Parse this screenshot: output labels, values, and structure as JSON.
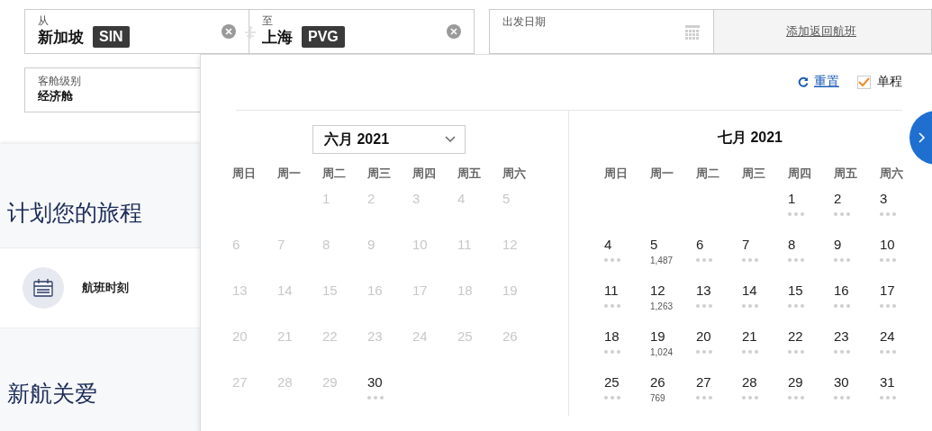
{
  "search": {
    "origin": {
      "label": "从",
      "city": "新加坡",
      "code": "SIN"
    },
    "destination": {
      "label": "至",
      "city": "上海",
      "code": "PVG"
    },
    "departure": {
      "label": "出发日期"
    },
    "return_link": "添加返回航班",
    "cabin": {
      "label": "客舱级别",
      "value": "经济舱"
    }
  },
  "sidebar": {
    "heading": "计划您的旅程",
    "items": [
      {
        "label": "航班时刻"
      }
    ],
    "heading_2": "新航关爱"
  },
  "calendar": {
    "reset": "重置",
    "one_way": {
      "label": "单程",
      "checked": true
    },
    "months": [
      {
        "title": "六月 2021",
        "kind": "select",
        "weekdays": [
          "周日",
          "周一",
          "周二",
          "周三",
          "周四",
          "周五",
          "周六"
        ],
        "weeks": [
          [
            {
              "kind": "empty"
            },
            {
              "kind": "empty"
            },
            {
              "kind": "day",
              "day": "1",
              "disabled": true,
              "dots": false
            },
            {
              "kind": "day",
              "day": "2",
              "disabled": true,
              "dots": false
            },
            {
              "kind": "day",
              "day": "3",
              "disabled": true,
              "dots": false
            },
            {
              "kind": "day",
              "day": "4",
              "disabled": true,
              "dots": false
            },
            {
              "kind": "day",
              "day": "5",
              "disabled": true,
              "dots": false
            }
          ],
          [
            {
              "kind": "day",
              "day": "6",
              "disabled": true,
              "dots": false
            },
            {
              "kind": "day",
              "day": "7",
              "disabled": true,
              "dots": false
            },
            {
              "kind": "day",
              "day": "8",
              "disabled": true,
              "dots": false
            },
            {
              "kind": "day",
              "day": "9",
              "disabled": true,
              "dots": false
            },
            {
              "kind": "day",
              "day": "10",
              "disabled": true,
              "dots": false
            },
            {
              "kind": "day",
              "day": "11",
              "disabled": true,
              "dots": false
            },
            {
              "kind": "day",
              "day": "12",
              "disabled": true,
              "dots": false
            }
          ],
          [
            {
              "kind": "day",
              "day": "13",
              "disabled": true,
              "dots": false
            },
            {
              "kind": "day",
              "day": "14",
              "disabled": true,
              "dots": false
            },
            {
              "kind": "day",
              "day": "15",
              "disabled": true,
              "dots": false
            },
            {
              "kind": "day",
              "day": "16",
              "disabled": true,
              "dots": false
            },
            {
              "kind": "day",
              "day": "17",
              "disabled": true,
              "dots": false
            },
            {
              "kind": "day",
              "day": "18",
              "disabled": true,
              "dots": false
            },
            {
              "kind": "day",
              "day": "19",
              "disabled": true,
              "dots": false
            }
          ],
          [
            {
              "kind": "day",
              "day": "20",
              "disabled": true,
              "dots": false
            },
            {
              "kind": "day",
              "day": "21",
              "disabled": true,
              "dots": false
            },
            {
              "kind": "day",
              "day": "22",
              "disabled": true,
              "dots": false
            },
            {
              "kind": "day",
              "day": "23",
              "disabled": true,
              "dots": false
            },
            {
              "kind": "day",
              "day": "24",
              "disabled": true,
              "dots": false
            },
            {
              "kind": "day",
              "day": "25",
              "disabled": true,
              "dots": false
            },
            {
              "kind": "day",
              "day": "26",
              "disabled": true,
              "dots": false
            }
          ],
          [
            {
              "kind": "day",
              "day": "27",
              "disabled": true,
              "dots": false
            },
            {
              "kind": "day",
              "day": "28",
              "disabled": true,
              "dots": false
            },
            {
              "kind": "day",
              "day": "29",
              "disabled": true,
              "dots": false
            },
            {
              "kind": "day",
              "day": "30",
              "disabled": false,
              "dots": true
            }
          ]
        ]
      },
      {
        "title": "七月 2021",
        "kind": "plain",
        "weekdays": [
          "周日",
          "周一",
          "周二",
          "周三",
          "周四",
          "周五",
          "周六"
        ],
        "weeks": [
          [
            {
              "kind": "empty"
            },
            {
              "kind": "empty"
            },
            {
              "kind": "empty"
            },
            {
              "kind": "empty"
            },
            {
              "kind": "day",
              "day": "1",
              "disabled": false,
              "dots": true
            },
            {
              "kind": "day",
              "day": "2",
              "disabled": false,
              "dots": true
            },
            {
              "kind": "day",
              "day": "3",
              "disabled": false,
              "dots": true
            }
          ],
          [
            {
              "kind": "day",
              "day": "4",
              "disabled": false,
              "dots": true
            },
            {
              "kind": "day",
              "day": "5",
              "disabled": false,
              "price": "1,487"
            },
            {
              "kind": "day",
              "day": "6",
              "disabled": false,
              "dots": true
            },
            {
              "kind": "day",
              "day": "7",
              "disabled": false,
              "dots": true
            },
            {
              "kind": "day",
              "day": "8",
              "disabled": false,
              "dots": true
            },
            {
              "kind": "day",
              "day": "9",
              "disabled": false,
              "dots": true
            },
            {
              "kind": "day",
              "day": "10",
              "disabled": false,
              "dots": true
            }
          ],
          [
            {
              "kind": "day",
              "day": "11",
              "disabled": false,
              "dots": true
            },
            {
              "kind": "day",
              "day": "12",
              "disabled": false,
              "price": "1,263"
            },
            {
              "kind": "day",
              "day": "13",
              "disabled": false,
              "dots": true
            },
            {
              "kind": "day",
              "day": "14",
              "disabled": false,
              "dots": true
            },
            {
              "kind": "day",
              "day": "15",
              "disabled": false,
              "dots": true
            },
            {
              "kind": "day",
              "day": "16",
              "disabled": false,
              "dots": true
            },
            {
              "kind": "day",
              "day": "17",
              "disabled": false,
              "dots": true
            }
          ],
          [
            {
              "kind": "day",
              "day": "18",
              "disabled": false,
              "dots": true
            },
            {
              "kind": "day",
              "day": "19",
              "disabled": false,
              "price": "1,024"
            },
            {
              "kind": "day",
              "day": "20",
              "disabled": false,
              "dots": true
            },
            {
              "kind": "day",
              "day": "21",
              "disabled": false,
              "dots": true
            },
            {
              "kind": "day",
              "day": "22",
              "disabled": false,
              "dots": true
            },
            {
              "kind": "day",
              "day": "23",
              "disabled": false,
              "dots": true
            },
            {
              "kind": "day",
              "day": "24",
              "disabled": false,
              "dots": true
            }
          ],
          [
            {
              "kind": "day",
              "day": "25",
              "disabled": false,
              "dots": true
            },
            {
              "kind": "day",
              "day": "26",
              "disabled": false,
              "price": "769"
            },
            {
              "kind": "day",
              "day": "27",
              "disabled": false,
              "dots": true
            },
            {
              "kind": "day",
              "day": "28",
              "disabled": false,
              "dots": true
            },
            {
              "kind": "day",
              "day": "29",
              "disabled": false,
              "dots": true
            },
            {
              "kind": "day",
              "day": "30",
              "disabled": false,
              "dots": true
            },
            {
              "kind": "day",
              "day": "31",
              "disabled": false,
              "dots": true
            }
          ]
        ]
      }
    ]
  }
}
